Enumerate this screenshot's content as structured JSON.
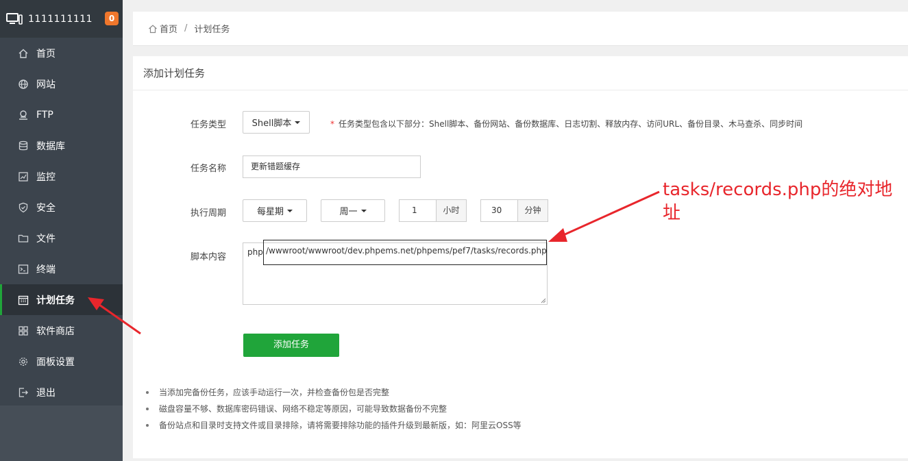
{
  "sidebar": {
    "server_name": "1111111111",
    "badge": "0",
    "items": [
      {
        "label": "首页",
        "icon": "home-icon"
      },
      {
        "label": "网站",
        "icon": "globe-icon"
      },
      {
        "label": "FTP",
        "icon": "ftp-icon"
      },
      {
        "label": "数据库",
        "icon": "database-icon"
      },
      {
        "label": "监控",
        "icon": "monitor-chart-icon"
      },
      {
        "label": "安全",
        "icon": "shield-icon"
      },
      {
        "label": "文件",
        "icon": "folder-icon"
      },
      {
        "label": "终端",
        "icon": "terminal-icon"
      },
      {
        "label": "计划任务",
        "icon": "calendar-icon"
      },
      {
        "label": "软件商店",
        "icon": "grid-icon"
      },
      {
        "label": "面板设置",
        "icon": "gear-icon"
      },
      {
        "label": "退出",
        "icon": "logout-icon"
      }
    ],
    "active_index": 8
  },
  "breadcrumb": {
    "home": "首页",
    "separator": "/",
    "current": "计划任务"
  },
  "form": {
    "title": "添加计划任务",
    "task_type_label": "任务类型",
    "task_type_value": "Shell脚本",
    "task_type_hint": "任务类型包含以下部分：Shell脚本、备份网站、备份数据库、日志切割、释放内存、访问URL、备份目录、木马查杀、同步时间",
    "task_name_label": "任务名称",
    "task_name_value": "更新错题缓存",
    "period_label": "执行周期",
    "period_value": "每星期",
    "weekday_value": "周一",
    "hour_value": "1",
    "hour_unit": "小时",
    "minute_value": "30",
    "minute_unit": "分钟",
    "script_label": "脚本内容",
    "script_prefix": "php",
    "script_path": "/wwwroot/wwwroot/dev.phpems.net/phpems/pef7/tasks/records.php",
    "submit_label": "添加任务"
  },
  "notes": [
    "当添加完备份任务，应该手动运行一次，并检查备份包是否完整",
    "磁盘容量不够、数据库密码错误、网络不稳定等原因，可能导致数据备份不完整",
    "备份站点和目录时支持文件或目录排除，请将需要排除功能的插件升级到最新版，如：阿里云OSS等"
  ],
  "annotation": {
    "text": "tasks/records.php的绝对地址",
    "color": "#e8262c"
  },
  "colors": {
    "sidebar_bg": "#3c444d",
    "accent_green": "#20a53a",
    "badge_orange": "#f0772c"
  }
}
